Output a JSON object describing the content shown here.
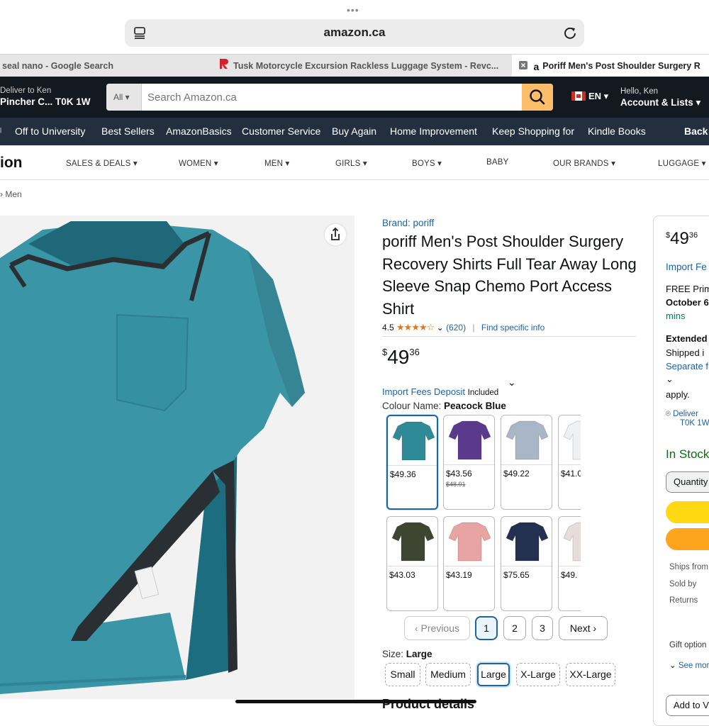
{
  "browser": {
    "url": "amazon.ca",
    "tabs": [
      {
        "label": "seal nano - Google Search",
        "active": false
      },
      {
        "label": "Tusk Motorcycle Excursion Rackless Luggage System - Revc...",
        "active": false
      },
      {
        "label": "Poriff Men's Post Shoulder Surgery R",
        "active": true
      }
    ]
  },
  "header": {
    "deliver_line1": "Deliver to Ken",
    "deliver_line2": "Pincher C... T0K 1W",
    "search_category": "All",
    "search_placeholder": "Search Amazon.ca",
    "lang": "EN",
    "account_line1": "Hello, Ken",
    "account_line2": "Account & Lists"
  },
  "nav_main": [
    "Off to University",
    "Best Sellers",
    "AmazonBasics",
    "Customer Service",
    "Buy Again",
    "Home Improvement",
    "Keep Shopping for",
    "Kindle Books",
    "Back"
  ],
  "subnav": {
    "brand": "ion",
    "items": [
      "SALES & DEALS ▾",
      "WOMEN ▾",
      "MEN ▾",
      "GIRLS ▾",
      "BOYS ▾",
      "BABY",
      "OUR BRANDS ▾",
      "LUGGAGE ▾"
    ]
  },
  "breadcrumb": "› Men",
  "product": {
    "brand_link": "Brand: poriff",
    "title": "poriff Men's Post Shoulder Surgery Recovery Shirts Full Tear Away Long Sleeve Snap Chemo Port Access Shirt",
    "rating": "4.5",
    "stars": "★★★★☆",
    "review_count": "(620)",
    "find_info": "Find specific info",
    "price_symbol": "$",
    "price_whole": "49",
    "price_fraction": "36",
    "import_fees": "Import Fees Deposit",
    "included": "Included",
    "colour_label": "Colour Name:",
    "colour_value": "Peacock Blue",
    "swatches": [
      {
        "price": "$49.36",
        "was": "",
        "color": "#2f8a98"
      },
      {
        "price": "$43.56",
        "was": "$48.91",
        "color": "#5b3a8c"
      },
      {
        "price": "$49.22",
        "was": "",
        "color": "#a9b6c8"
      },
      {
        "price": "$41.0",
        "was": "",
        "color": "#eef0f2"
      },
      {
        "price": "$43.03",
        "was": "",
        "color": "#3e4632"
      },
      {
        "price": "$43.19",
        "was": "",
        "color": "#e8a3a3"
      },
      {
        "price": "$75.65",
        "was": "",
        "color": "#23304f"
      },
      {
        "price": "$49.",
        "was": "",
        "color": "#e7dcdc"
      }
    ],
    "pagination": {
      "previous": "‹ Previous",
      "pages": [
        "1",
        "2",
        "3"
      ],
      "next": "Next ›"
    },
    "size_label": "Size:",
    "size_value": "Large",
    "sizes": [
      "Small",
      "Medium",
      "Large",
      "X-Large",
      "XX-Large"
    ],
    "details_heading": "Product details"
  },
  "buybox": {
    "price_symbol": "$",
    "price_whole": "49",
    "price_fraction": "36",
    "import_fees": "Import Fe",
    "free_prime": "FREE Prim",
    "date": "October 6",
    "mins": "mins",
    "extended": "Extended",
    "shipped": "Shipped i",
    "separate": "Separate f",
    "apply": "apply.",
    "deliver_to": "Deliver",
    "postcode": "T0K 1W",
    "in_stock": "In Stock",
    "quantity": "Quantity",
    "ships_from": "Ships from",
    "sold_by": "Sold by",
    "returns": "Returns",
    "gift_options": "Gift option",
    "see_more": "See mor",
    "add_to": "Add to V"
  }
}
